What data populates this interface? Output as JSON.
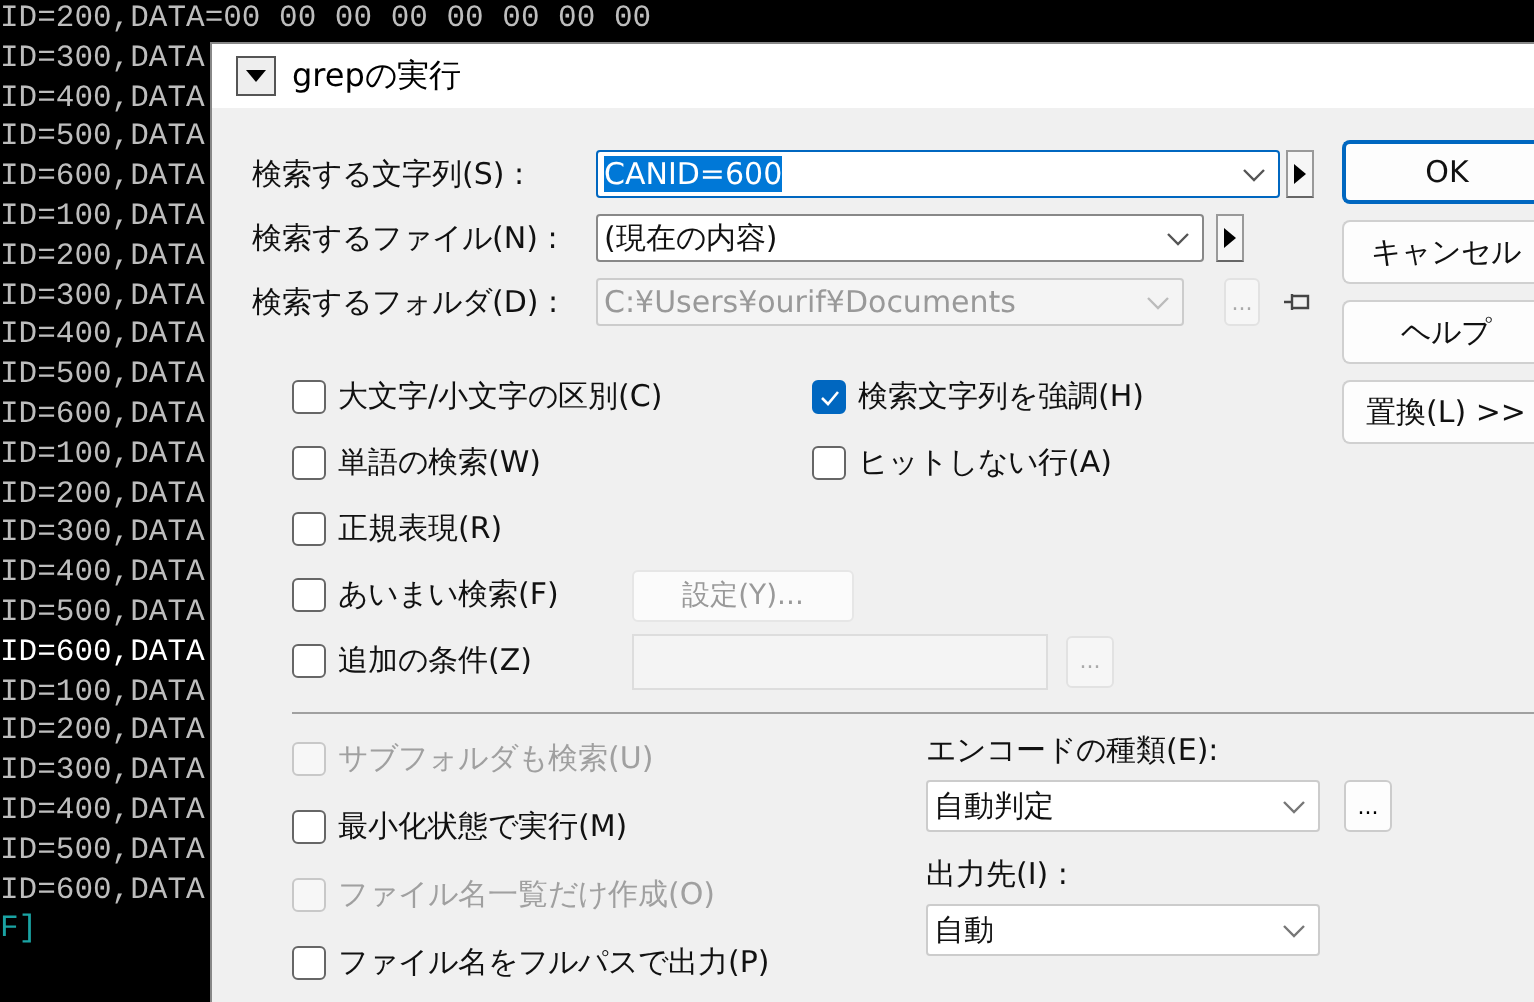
{
  "terminal": {
    "lines": [
      {
        "text": "ID=200,DATA=00 00 00 00 00 00 00 00",
        "bright": false
      },
      {
        "text": "ID=300,DATA",
        "bright": false
      },
      {
        "text": "ID=400,DATA",
        "bright": false
      },
      {
        "text": "ID=500,DATA",
        "bright": false
      },
      {
        "text": "ID=600,DATA",
        "bright": false
      },
      {
        "text": "ID=100,DATA",
        "bright": false
      },
      {
        "text": "ID=200,DATA",
        "bright": false
      },
      {
        "text": "ID=300,DATA",
        "bright": false
      },
      {
        "text": "ID=400,DATA",
        "bright": false
      },
      {
        "text": "ID=500,DATA",
        "bright": false
      },
      {
        "text": "ID=600,DATA",
        "bright": false
      },
      {
        "text": "ID=100,DATA",
        "bright": false
      },
      {
        "text": "ID=200,DATA",
        "bright": false
      },
      {
        "text": "ID=300,DATA",
        "bright": false
      },
      {
        "text": "ID=400,DATA",
        "bright": false
      },
      {
        "text": "ID=500,DATA",
        "bright": false
      },
      {
        "text": "ID=600,DATA",
        "bright": true
      },
      {
        "text": "ID=100,DATA",
        "bright": false
      },
      {
        "text": "ID=200,DATA",
        "bright": false
      },
      {
        "text": "ID=300,DATA",
        "bright": false
      },
      {
        "text": "ID=400,DATA",
        "bright": false
      },
      {
        "text": "ID=500,DATA",
        "bright": false
      },
      {
        "text": "ID=600,DATA",
        "bright": false
      }
    ],
    "prompt": "F]"
  },
  "dialog": {
    "title": "grepの実行",
    "fields": [
      {
        "label": "検索する文字列(S) :",
        "value": "CANID=600",
        "highlighted": true,
        "focused": true,
        "disabled": false,
        "extra": {
          "kind": "arrow"
        }
      },
      {
        "label": "検索するファイル(N) :",
        "value": "(現在の内容)",
        "highlighted": false,
        "focused": false,
        "disabled": false,
        "extra": {
          "kind": "arrow"
        }
      },
      {
        "label": "検索するフォルダ(D) :",
        "value": "C:¥Users¥ourif¥Documents",
        "highlighted": false,
        "focused": false,
        "disabled": true,
        "extra": {
          "kind": "browse",
          "button": "..."
        }
      }
    ],
    "buttons": [
      {
        "label": "OK",
        "default": true
      },
      {
        "label": "キャンセル",
        "default": false
      },
      {
        "label": "ヘルプ",
        "default": false
      },
      {
        "label": "置換(L) >>",
        "default": false
      }
    ],
    "options": [
      {
        "items": [
          {
            "kind": "checkbox",
            "label": "大文字/小文字の区別(C)",
            "checked": false,
            "disabled": false
          },
          {
            "kind": "checkbox",
            "label": "検索文字列を強調(H)",
            "checked": true,
            "disabled": false
          }
        ]
      },
      {
        "items": [
          {
            "kind": "checkbox",
            "label": "単語の検索(W)",
            "checked": false,
            "disabled": false
          },
          {
            "kind": "checkbox",
            "label": "ヒットしない行(A)",
            "checked": false,
            "disabled": false
          }
        ]
      },
      {
        "items": [
          {
            "kind": "checkbox",
            "label": "正規表現(R)",
            "checked": false,
            "disabled": false
          }
        ]
      },
      {
        "items": [
          {
            "kind": "checkbox",
            "label": "あいまい検索(F)",
            "checked": false,
            "disabled": false
          },
          {
            "kind": "button",
            "label": "設定(Y)...",
            "disabled": true
          }
        ]
      },
      {
        "items": [
          {
            "kind": "checkbox",
            "label": "追加の条件(Z)",
            "checked": false,
            "disabled": false
          },
          {
            "kind": "field",
            "disabled": true
          },
          {
            "kind": "small-button",
            "label": "...",
            "disabled": true
          }
        ]
      }
    ],
    "more_options": [
      {
        "label": "サブフォルダも検索(U)",
        "checked": false,
        "disabled": true
      },
      {
        "label": "最小化状態で実行(M)",
        "checked": false,
        "disabled": false
      },
      {
        "label": "ファイル名一覧だけ作成(O)",
        "checked": false,
        "disabled": true
      },
      {
        "label": "ファイル名をフルパスで出力(P)",
        "checked": false,
        "disabled": false
      }
    ],
    "settings": [
      {
        "label": "エンコードの種類(E):",
        "value": "自動判定",
        "button": "..."
      },
      {
        "label": "出力先(I) :",
        "value": "自動"
      }
    ]
  }
}
